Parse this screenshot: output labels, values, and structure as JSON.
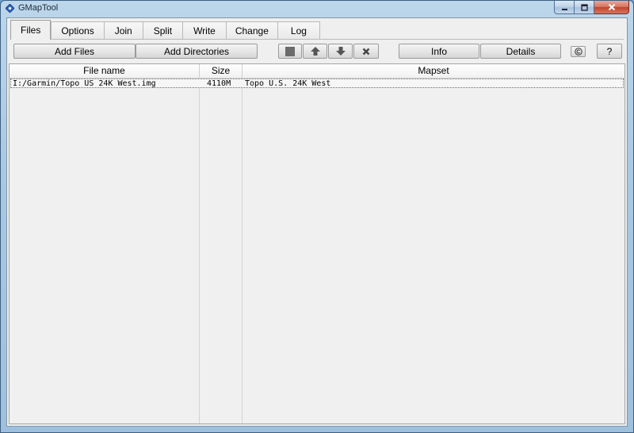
{
  "window": {
    "title": "GMapTool"
  },
  "tabs": [
    {
      "label": "Files",
      "active": true
    },
    {
      "label": "Options"
    },
    {
      "label": "Join"
    },
    {
      "label": "Split"
    },
    {
      "label": "Write"
    },
    {
      "label": "Change"
    },
    {
      "label": "Log"
    }
  ],
  "toolbar": {
    "add_files": "Add Files",
    "add_directories": "Add Directories",
    "info": "Info",
    "details": "Details",
    "help": "?"
  },
  "icons": {
    "stop": "stop-icon",
    "move_up": "arrow-up-icon",
    "move_down": "arrow-down-icon",
    "remove": "x-icon",
    "copyright": "copyright-icon"
  },
  "table": {
    "columns": [
      "File name",
      "Size",
      "Mapset"
    ],
    "rows": [
      {
        "file": "I:/Garmin/Topo US 24K West.img",
        "size": "4110M",
        "mapset": "Topo U.S. 24K West"
      }
    ]
  }
}
